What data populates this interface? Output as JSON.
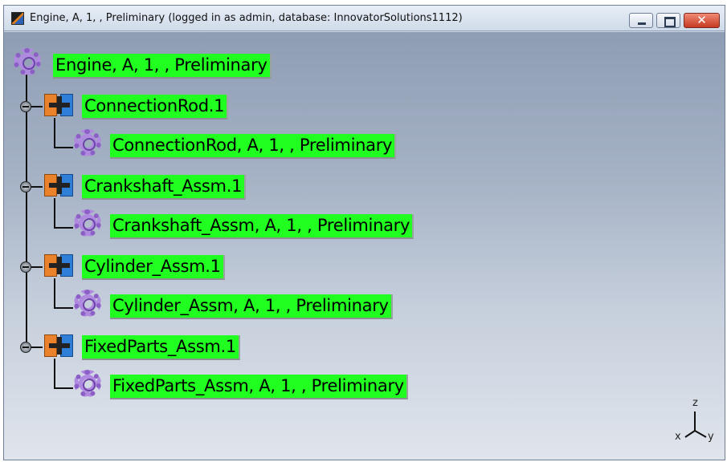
{
  "window": {
    "title": "Engine, A, 1, , Preliminary (logged in as admin, database: InnovatorSolutions1112)",
    "buttons": {
      "minimize_icon": "minimize-icon",
      "maximize_icon": "maximize-icon",
      "close_glyph": "✕"
    }
  },
  "tree": {
    "root": {
      "label": "Engine, A, 1, , Preliminary",
      "icon": "gear-icon"
    },
    "children": [
      {
        "instance": "ConnectionRod.1",
        "part": "ConnectionRod, A, 1, , Preliminary"
      },
      {
        "instance": "Crankshaft_Assm.1",
        "part": "Crankshaft_Assm, A, 1, , Preliminary"
      },
      {
        "instance": "Cylinder_Assm.1",
        "part": "Cylinder_Assm, A, 1, , Preliminary"
      },
      {
        "instance": "FixedParts_Assm.1",
        "part": "FixedParts_Assm, A, 1, , Preliminary"
      }
    ]
  },
  "axis": {
    "x": "x",
    "y": "y",
    "z": "z"
  },
  "colors": {
    "node_background": "#20ff20",
    "gear": "#8b5fc6"
  }
}
